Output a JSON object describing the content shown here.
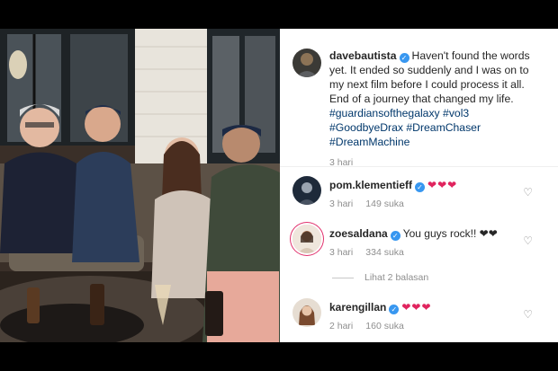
{
  "post": {
    "username": "davebautista",
    "caption": "Haven't found the words yet. It ended so suddenly and I was on to my next film before I could process it all. End of a journey that changed my life.",
    "hashtags": [
      "#guardiansofthegalaxy",
      "#vol3",
      "#GoodbyeDrax",
      "#DreamChaser",
      "#DreamMachine"
    ],
    "time": "3 hari"
  },
  "comments": [
    {
      "username": "pom.klementieff",
      "text": "❤❤❤",
      "time": "3 hari",
      "likes": "149 suka"
    },
    {
      "username": "zoesaldana",
      "text": "You guys rock!! ❤❤",
      "time": "3 hari",
      "likes": "334 suka"
    },
    {
      "username": "karengillan",
      "text": "❤❤❤",
      "time": "2 hari",
      "likes": "160 suka"
    }
  ],
  "replies_label": "Lihat 2 balasan",
  "colors": {
    "verified": "#3897f0",
    "hashtag": "#00376b",
    "muted": "#8e8e8e",
    "heart": "#e0245e"
  },
  "icons": {
    "verified": "verified-badge-icon",
    "like": "heart-outline-icon"
  }
}
